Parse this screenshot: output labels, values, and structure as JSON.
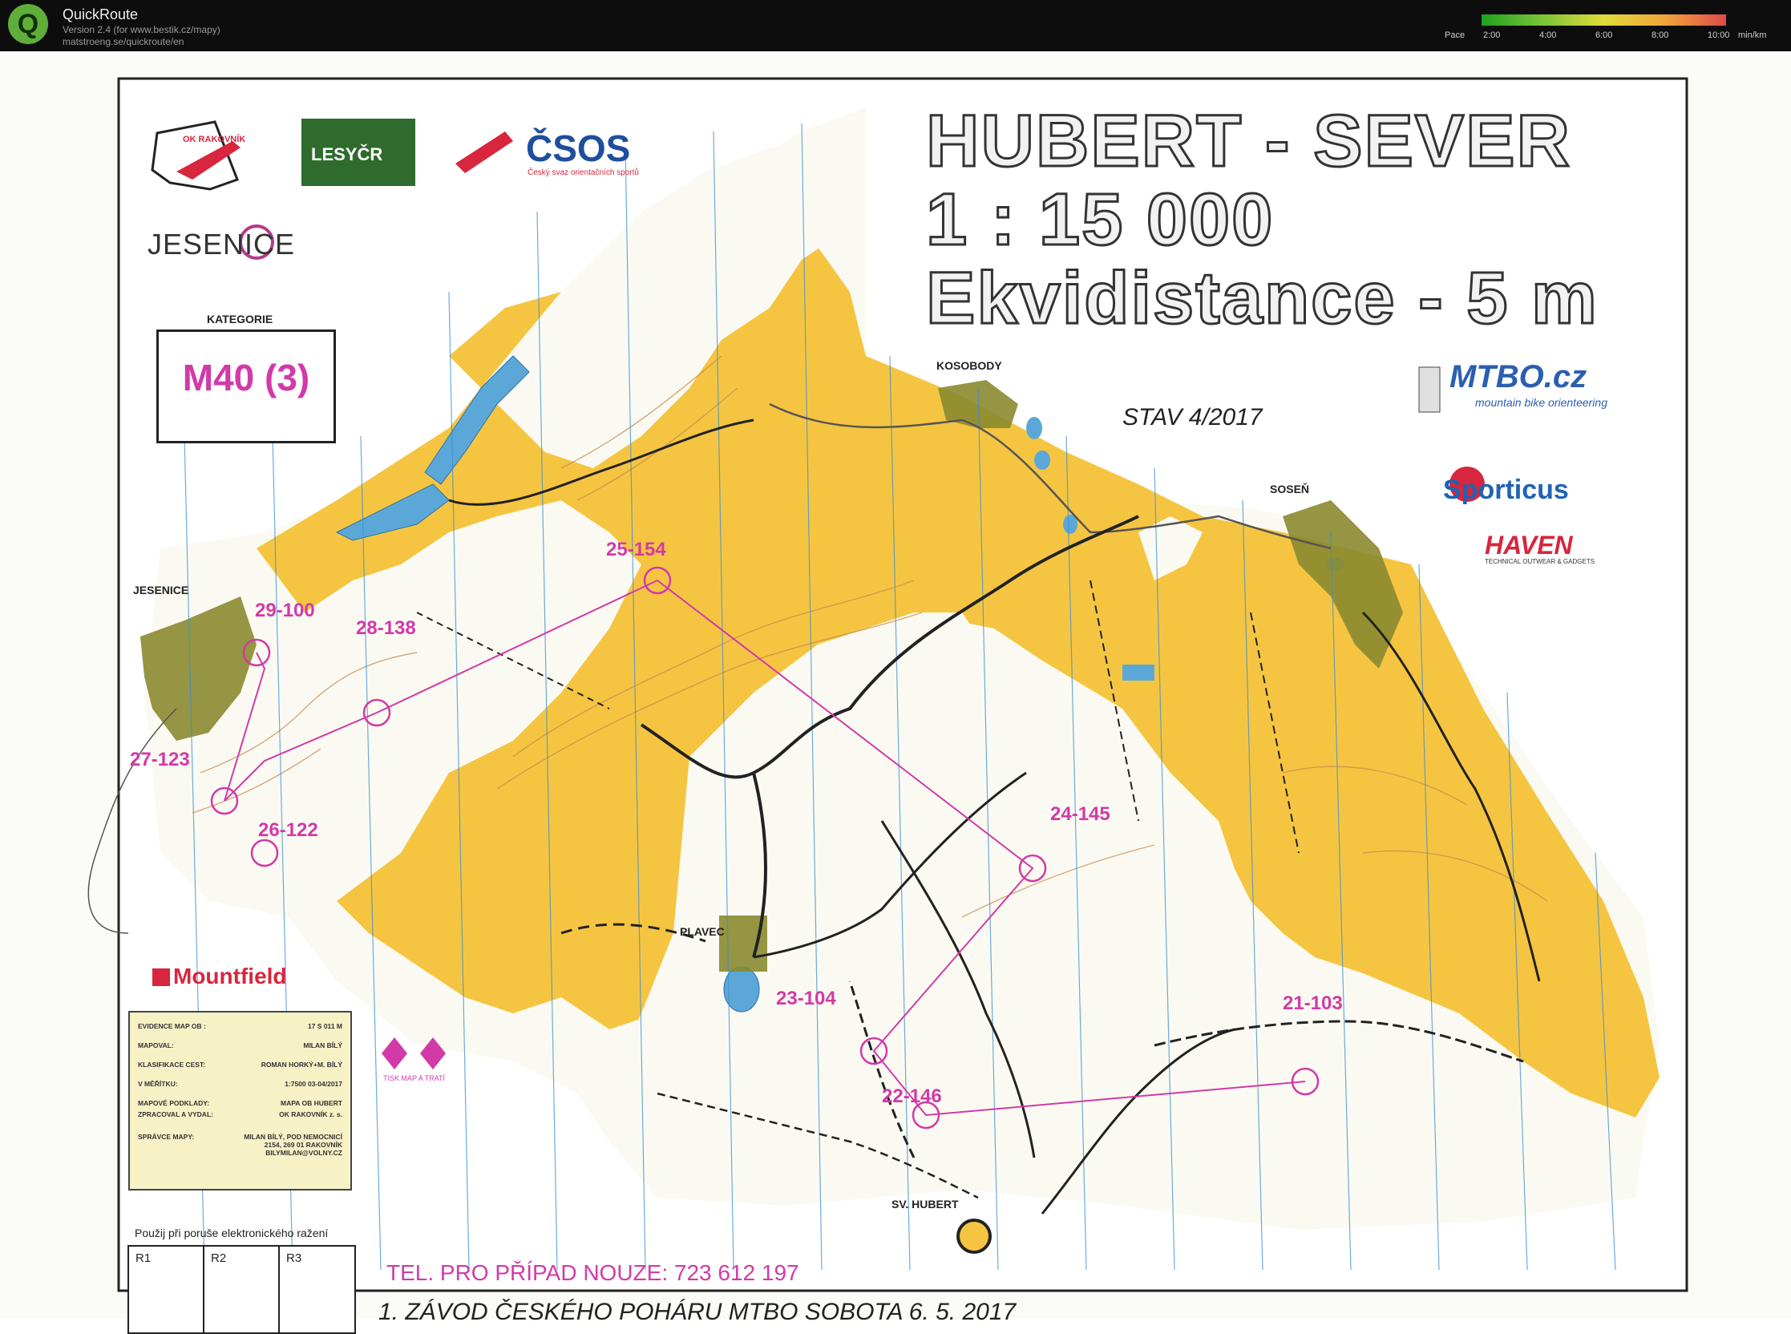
{
  "app": {
    "title": "QuickRoute",
    "logo_letter": "Q",
    "version": "Version 2.4  (for www.bestik.cz/mapy)",
    "url": "matstroeng.se/quickroute/en"
  },
  "pace_legend": {
    "label": "Pace",
    "ticks": [
      "2:00",
      "4:00",
      "6:00",
      "8:00",
      "10:00"
    ],
    "unit": "min/km"
  },
  "map": {
    "title_lines": [
      "HUBERT - SEVER",
      "1 : 15 000",
      "Ekvidistance - 5 m"
    ],
    "status": "STAV 4/2017",
    "category_label": "KATEGORIE",
    "category_value": "M40 (3)",
    "phone": "TEL. PRO PŘÍPAD NOUZE: 723 612 197",
    "race": "1. ZÁVOD ČESKÉHO POHÁRU MTBO SOBOTA 6. 5. 2017",
    "backup_label": "Použij při poruše elektronického ražení",
    "backup_cells": [
      "R1",
      "R2",
      "R3"
    ],
    "places": {
      "jesenice": "JESENICE",
      "kosobody": "KOSOBODY",
      "sosen": "SOSEŇ",
      "plavec": "PLAVEC",
      "sv_hubert": "SV. HUBERT"
    },
    "controls": [
      "29-100",
      "28-138",
      "27-123",
      "26-122",
      "25-154",
      "24-145",
      "23-104",
      "22-146",
      "21-103"
    ],
    "sponsors": {
      "ok_rakovnik": "OK RAKOVNÍK",
      "lesy_cr": "LESYČR",
      "csos": "ČSOS",
      "csos_sub": "Český svaz orientačních sportů",
      "jesenice_logo": "JESENICE",
      "mtbo": "MTBO.cz",
      "mtbo_sub": "mountain bike orienteering",
      "sporticus": "Sporticus",
      "haven": "HAVEN",
      "haven_sub": "TECHNICAL OUTWEAR & GADGETS",
      "mountfield": "Mountfield",
      "zaket_sub": "TISK MAP A TRATÍ"
    },
    "legend_rows": [
      {
        "label": "EVIDENCE MAP OB :",
        "value": "17 S 011 M"
      },
      {
        "label": "MAPOVAL:",
        "value": "MILAN BÍLÝ"
      },
      {
        "label": "KLASIFIKACE CEST:",
        "value": "ROMAN HORKÝ+M. BÍLÝ"
      },
      {
        "label": "V MĚŘÍTKU:",
        "value": "1:7500  03-04/2017"
      },
      {
        "label": "MAPOVÉ PODKLADY:",
        "value": "MAPA OB HUBERT"
      },
      {
        "label": "ZPRACOVAL A VYDAL:",
        "value": "OK RAKOVNÍK z. s."
      },
      {
        "label": "SPRÁVCE MAPY:",
        "value": "MILAN BÍLÝ, POD NEMOCNICÍ 2154, 269 01 RAKOVNÍK BILYMILAN@VOLNY.CZ"
      }
    ],
    "colors": {
      "open": "#f5c542",
      "forest": "#fbfbf8",
      "water": "#5ba8d8",
      "course": "#d23aa8",
      "road": "#222222",
      "village": "#8a8a30",
      "contour": "#c8864a",
      "meridian": "#3a8fd6"
    }
  }
}
